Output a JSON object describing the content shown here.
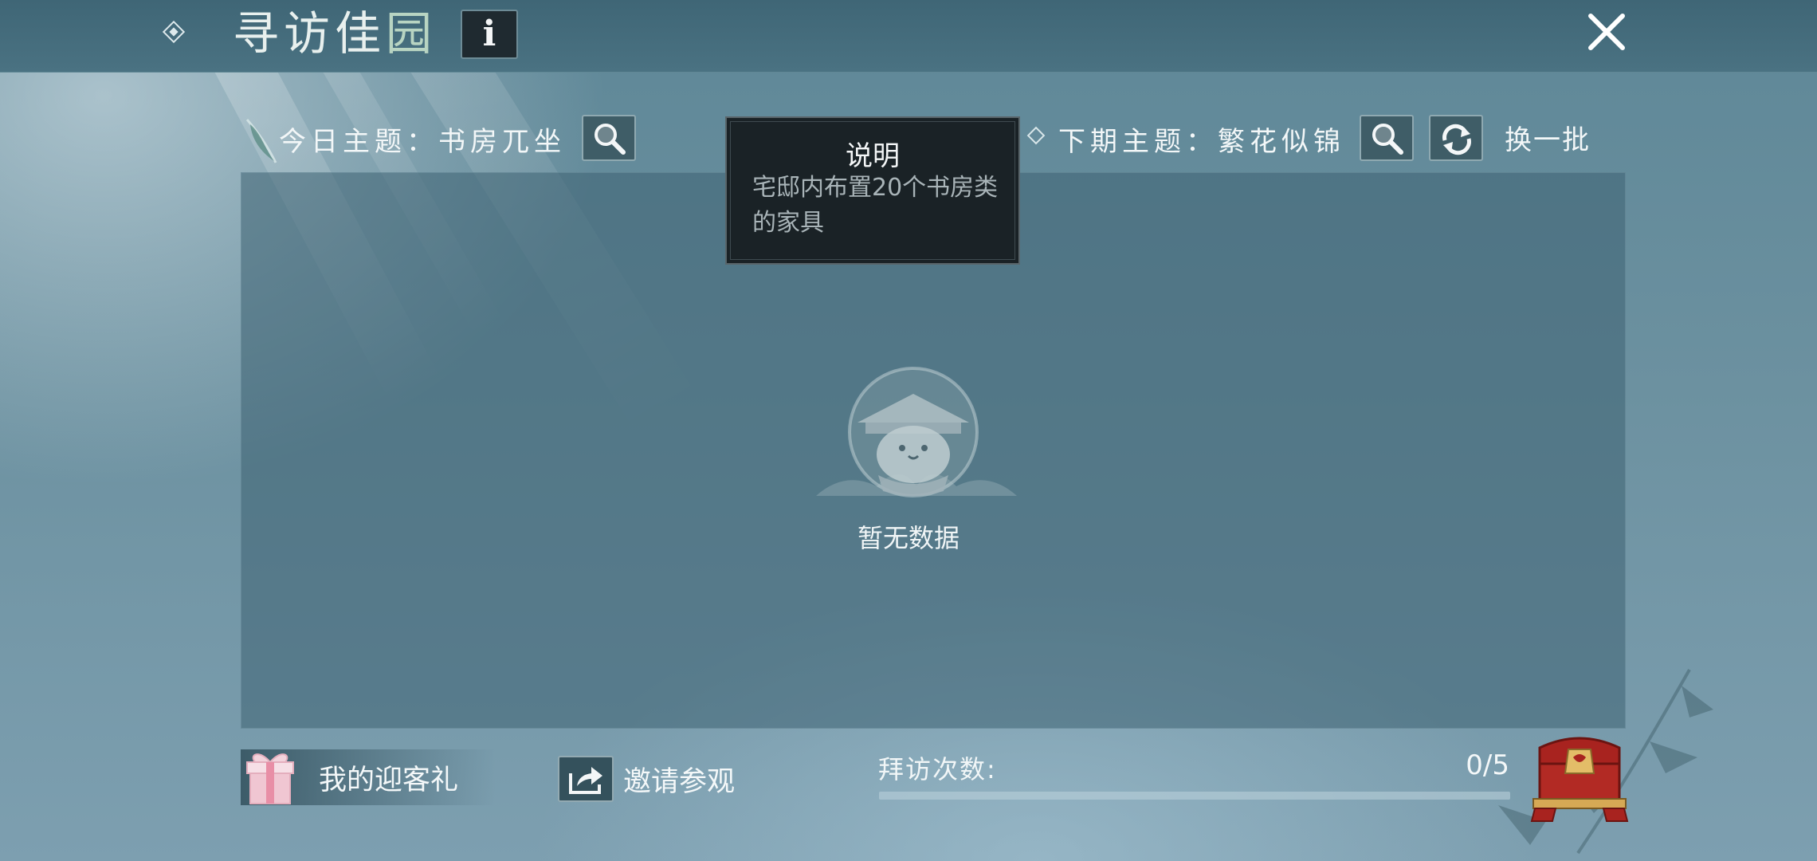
{
  "header": {
    "title": "寻访佳园",
    "info_label": "i"
  },
  "themes": {
    "today": "今日主题：书房兀坐",
    "next": "下期主题：繁花似锦",
    "refresh_label": "换一批"
  },
  "tooltip": {
    "title": "说明",
    "body": "宅邸内布置20个书房类的家具"
  },
  "empty_state": {
    "text": "暂无数据"
  },
  "footer": {
    "gift_label": "我的迎客礼",
    "invite_label": "邀请参观",
    "visit_label": "拜访次数:",
    "visit_count": "0/5",
    "visit_progress": 0
  },
  "colors": {
    "accent": "#e2c48a",
    "chest_red": "#a8231f"
  }
}
